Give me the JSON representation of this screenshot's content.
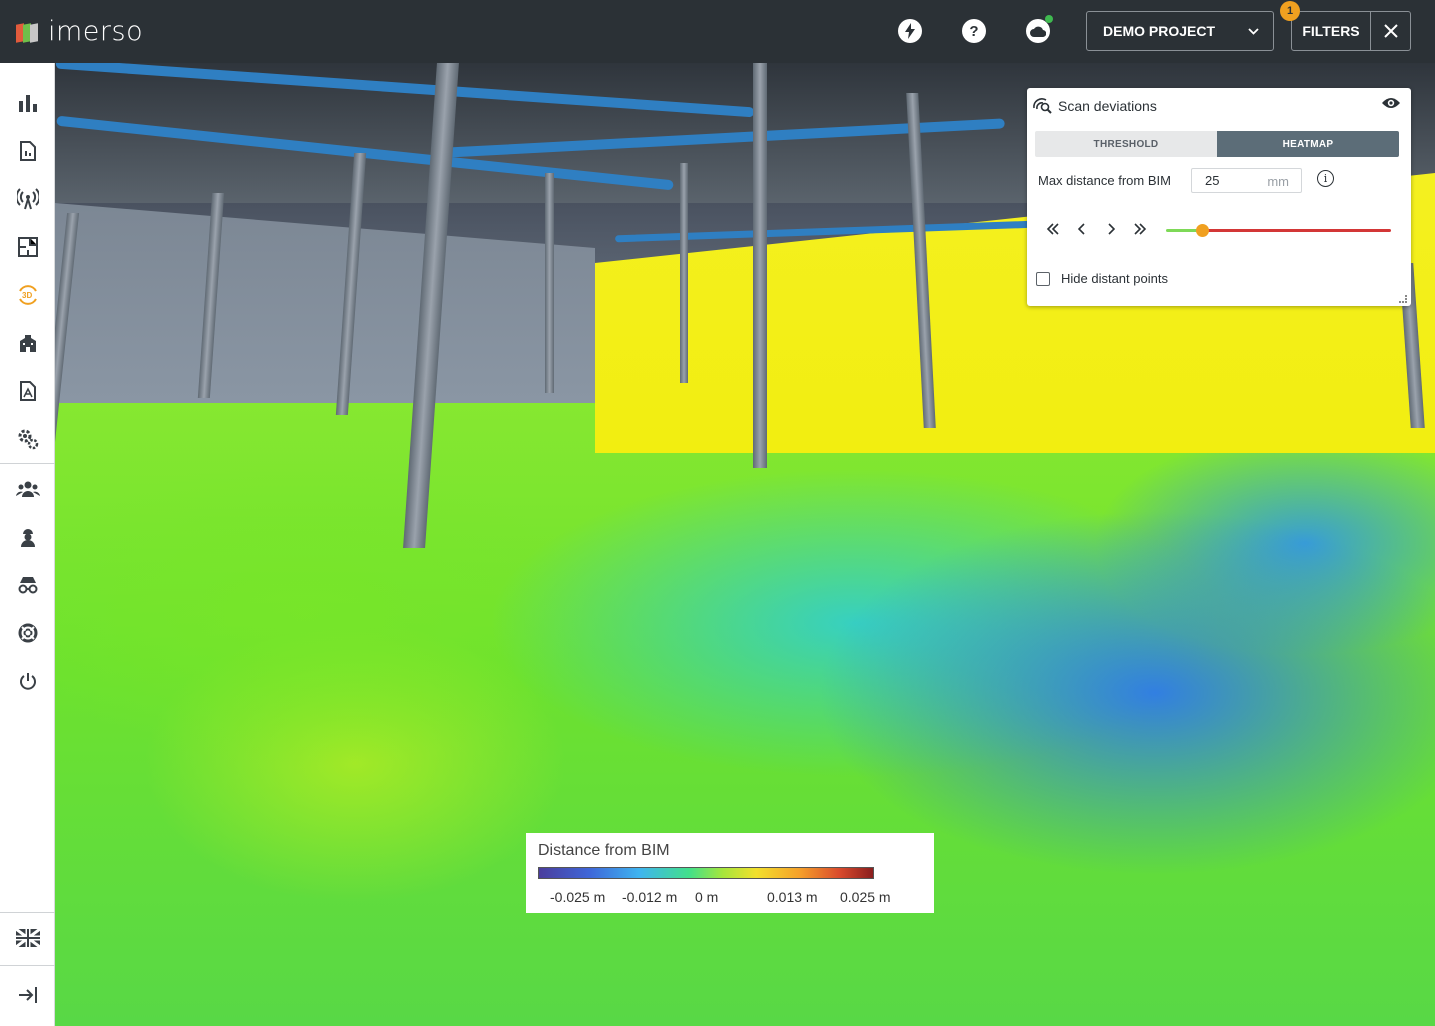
{
  "app": {
    "logo_text": "imerso"
  },
  "topbar": {
    "project_name": "DEMO PROJECT",
    "filters_label": "FILTERS",
    "filters_badge": "1",
    "quick_action_icon": "bolt-icon",
    "help_icon": "question-icon",
    "cloud_icon": "cloud-status-icon",
    "cloud_status_color": "#3fb950"
  },
  "sidebar": {
    "items": [
      {
        "name": "dashboard",
        "icon": "bar-chart-icon"
      },
      {
        "name": "documents",
        "icon": "document-icon"
      },
      {
        "name": "scans",
        "icon": "scan-antenna-icon"
      },
      {
        "name": "floor-plans",
        "icon": "floor-plan-icon"
      },
      {
        "name": "3d-view",
        "icon": "3d-rotate-icon",
        "active": true
      },
      {
        "name": "buildings",
        "icon": "building-icon"
      },
      {
        "name": "reports",
        "icon": "report-icon"
      },
      {
        "name": "settings",
        "icon": "gears-icon"
      },
      {
        "name": "team",
        "icon": "group-icon"
      },
      {
        "name": "workers",
        "icon": "worker-icon"
      },
      {
        "name": "incognito",
        "icon": "spy-icon"
      },
      {
        "name": "support",
        "icon": "lifebuoy-icon"
      },
      {
        "name": "logout",
        "icon": "power-icon"
      },
      {
        "name": "language",
        "icon": "uk-flag-icon"
      },
      {
        "name": "collapse",
        "icon": "expand-right-icon"
      }
    ],
    "active_color": "#f0a020"
  },
  "scan_panel": {
    "title": "Scan deviations",
    "tabs": [
      {
        "label": "THRESHOLD",
        "active": false
      },
      {
        "label": "HEATMAP",
        "active": true
      }
    ],
    "max_distance_label": "Max distance from BIM",
    "max_distance_value": "25",
    "max_distance_unit": "mm",
    "slider_level": 0.16,
    "hide_distant_label": "Hide distant points",
    "hide_distant_checked": false
  },
  "legend": {
    "title": "Distance from BIM",
    "labels": [
      "-0.025 m",
      "-0.012 m",
      "0 m",
      "0.013 m",
      "0.025 m"
    ]
  }
}
